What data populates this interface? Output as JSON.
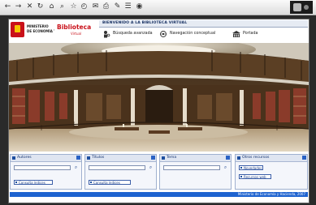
{
  "browser": {
    "buttons": [
      {
        "name": "back-icon",
        "glyph": "←"
      },
      {
        "name": "forward-icon",
        "glyph": "→"
      },
      {
        "name": "stop-icon",
        "glyph": "✕"
      },
      {
        "name": "refresh-icon",
        "glyph": "↻"
      },
      {
        "name": "home-icon",
        "glyph": "⌂"
      },
      {
        "name": "search-icon",
        "glyph": "⌕"
      },
      {
        "name": "favorites-icon",
        "glyph": "☆"
      },
      {
        "name": "history-icon",
        "glyph": "◴"
      },
      {
        "name": "mail-icon",
        "glyph": "✉"
      },
      {
        "name": "print-icon",
        "glyph": "⎙"
      },
      {
        "name": "edit-icon",
        "glyph": "✎"
      },
      {
        "name": "discuss-icon",
        "glyph": "☰"
      },
      {
        "name": "messenger-icon",
        "glyph": "◉"
      }
    ]
  },
  "header": {
    "logo_line1": "MINISTERIO",
    "logo_line2": "DE ECONOMÍA Y HACIENDA",
    "brand": "Biblioteca",
    "brand_sub": "Virtual",
    "site_title": "BIENVENIDO A LA BIBLIOTECA VIRTUAL",
    "nav": [
      {
        "label": "Búsqueda avanzada",
        "icon": "person-search-icon"
      },
      {
        "label": "Navegación conceptual",
        "icon": "network-icon"
      },
      {
        "label": "Portada",
        "icon": "building-icon"
      }
    ]
  },
  "panels": [
    {
      "title": "Autores",
      "links": [
        "Consulta índices"
      ]
    },
    {
      "title": "Títulos",
      "links": [
        "Consulta índices"
      ]
    },
    {
      "title": "Tema",
      "links": []
    },
    {
      "title": "Otros recursos",
      "links": [
        "Novedades",
        "Recursos web"
      ]
    }
  ],
  "footer": {
    "text": "Ministerio de Economía y Hacienda, 2007"
  },
  "colors": {
    "accent": "#1e63d0",
    "brand_red": "#c9111a",
    "panel_header": "#dfe5f1"
  }
}
